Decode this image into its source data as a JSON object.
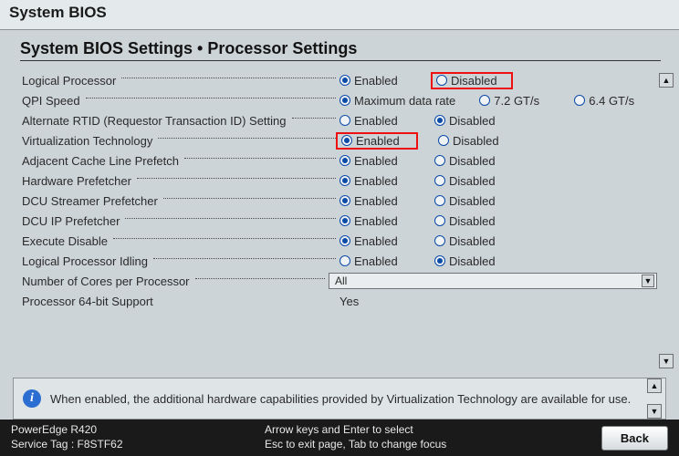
{
  "title": "System BIOS",
  "breadcrumb": "System BIOS Settings • Processor Settings",
  "options": {
    "enabled": "Enabled",
    "disabled": "Disabled"
  },
  "rows": [
    {
      "label": "Logical Processor",
      "type": "radio2",
      "selected": "enabled",
      "highlight_disabled": true
    },
    {
      "label": "QPI Speed",
      "type": "qpi",
      "selected": "max",
      "opt_max": "Maximum data rate",
      "opt_72": "7.2 GT/s",
      "opt_64": "6.4 GT/s"
    },
    {
      "label": "Alternate RTID (Requestor Transaction ID) Setting",
      "type": "radio2",
      "selected": "disabled"
    },
    {
      "label": "Virtualization Technology",
      "type": "radio2",
      "selected": "enabled",
      "highlight_enabled": true
    },
    {
      "label": "Adjacent Cache Line Prefetch",
      "type": "radio2",
      "selected": "enabled"
    },
    {
      "label": "Hardware Prefetcher",
      "type": "radio2",
      "selected": "enabled"
    },
    {
      "label": "DCU Streamer Prefetcher",
      "type": "radio2",
      "selected": "enabled"
    },
    {
      "label": "DCU IP Prefetcher",
      "type": "radio2",
      "selected": "enabled"
    },
    {
      "label": "Execute Disable",
      "type": "radio2",
      "selected": "enabled"
    },
    {
      "label": "Logical Processor Idling",
      "type": "radio2",
      "selected": "disabled"
    },
    {
      "label": "Number of Cores per Processor",
      "type": "select",
      "value": "All"
    },
    {
      "label": "Processor 64-bit Support",
      "type": "static",
      "value": "Yes"
    }
  ],
  "help_text": "When enabled, the additional hardware capabilities provided by Virtualization Technology are available for use.",
  "footer": {
    "model": "PowerEdge R420",
    "service_tag_label": "Service Tag :",
    "service_tag": "F8STF62",
    "hint1": "Arrow keys and Enter to select",
    "hint2": "Esc to exit page, Tab to change focus",
    "back": "Back"
  }
}
